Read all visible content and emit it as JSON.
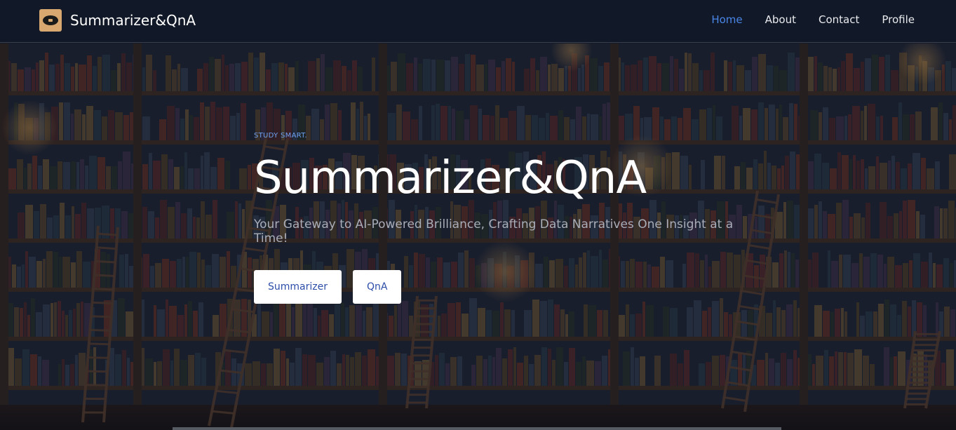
{
  "navbar": {
    "brand": "Summarizer&QnA",
    "links": [
      {
        "label": "Home",
        "active": true
      },
      {
        "label": "About",
        "active": false
      },
      {
        "label": "Contact",
        "active": false
      },
      {
        "label": "Profile",
        "active": false
      }
    ]
  },
  "hero": {
    "eyebrow": "STUDY SMART.",
    "title": "Summarizer&QnA",
    "subtitle": "Your Gateway to AI-Powered Brilliance, Crafting Data Narratives One Insight at a Time!",
    "buttons": [
      {
        "label": "Summarizer"
      },
      {
        "label": "QnA"
      }
    ]
  },
  "colors": {
    "nav_bg": "#111827",
    "accent": "#4a86e8",
    "button_text": "#2d4ea8"
  }
}
